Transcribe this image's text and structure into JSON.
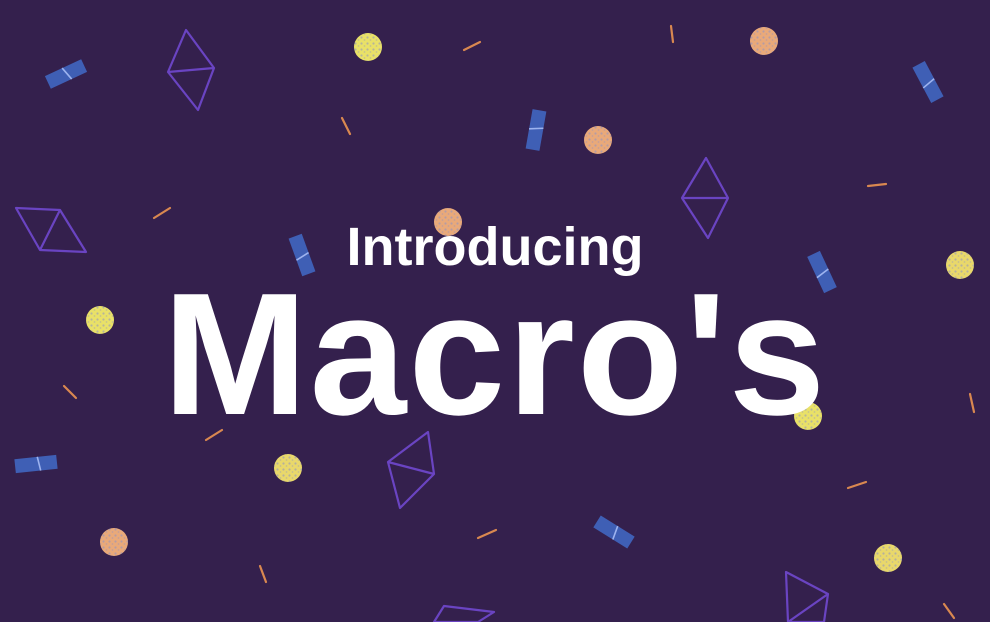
{
  "hero": {
    "eyebrow": "Introducing",
    "headline": "Macro's"
  },
  "colors": {
    "background": "#34204d",
    "text": "#ffffff",
    "triangle_outline": "#6a44c2",
    "tile_blue": "#3f5fb5",
    "tile_stripe": "#9db3ef",
    "dot_yellow": "#e9e167",
    "dot_orange": "#e9a979",
    "dot_speckle": "#8a8fc6",
    "dash": "#d98850"
  },
  "decoration": {
    "style": "confetti",
    "shapes": [
      "outlined-diamond",
      "striped-tile",
      "speckled-dot",
      "short-dash"
    ]
  }
}
